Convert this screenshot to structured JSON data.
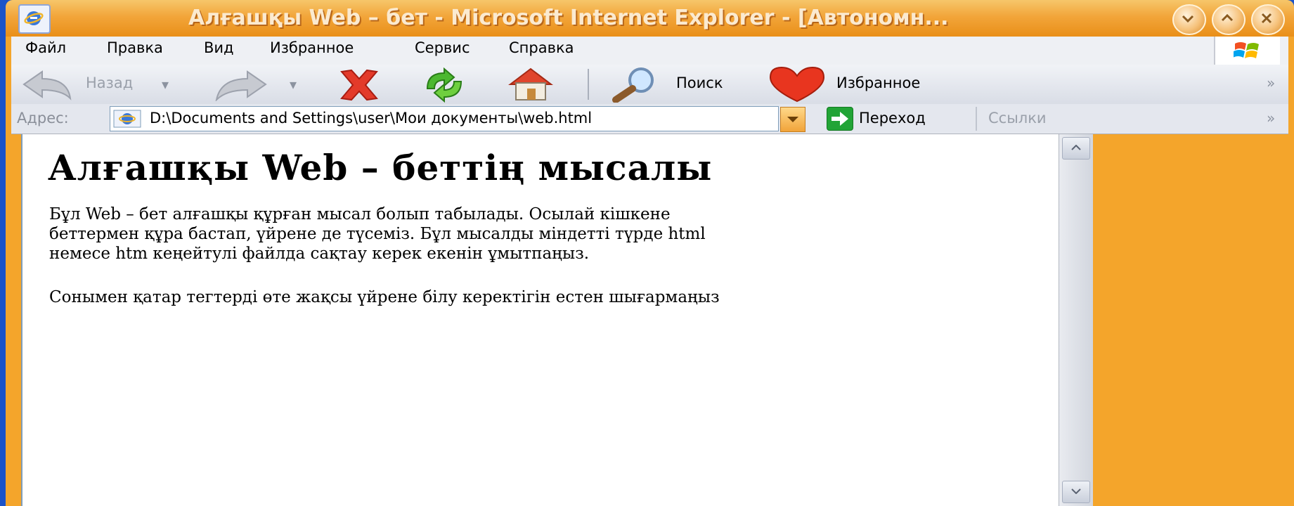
{
  "window": {
    "title": "Алғашқы Web – бет - Microsoft Internet Explorer - [Автономн...",
    "caption_buttons": [
      "minimize-icon",
      "maximize-icon",
      "close-icon"
    ]
  },
  "menu": {
    "items": [
      {
        "label": "Файл"
      },
      {
        "label": "Правка"
      },
      {
        "label": "Вид"
      },
      {
        "label": "Избранное"
      },
      {
        "label": "Сервис"
      },
      {
        "label": "Справка"
      }
    ]
  },
  "toolbar": {
    "back_label": "Назад",
    "search_label": "Поиск",
    "favorites_label": "Избранное",
    "more_chevron": "»",
    "icons": [
      "back-arrow-icon",
      "forward-arrow-icon",
      "stop-icon",
      "refresh-icon",
      "home-icon",
      "search-icon",
      "favorites-heart-icon"
    ]
  },
  "address": {
    "label": "Адрес:",
    "value": "D:\\Documents and Settings\\user\\Мои документы\\web.html",
    "go_label": "Переход",
    "links_label": "Ссылки",
    "links_chevron": "»"
  },
  "page": {
    "heading": "Алғашқы Web – беттің мысалы",
    "paragraph1_lines": [
      "Бұл Web – бет алғашқы құрған мысал болып табылады. Осылай кішкене",
      "беттермен құра бастап, үйрене де түсеміз. Бұл мысалды міндетті түрде html",
      "немесе htm кеңейтулі файлда сақтау керек екенін ұмытпаңыз."
    ],
    "paragraph2": "Сонымен қатар тегтерді өте жақсы үйрене білу керектігін естен шығармаңыз"
  },
  "colors": {
    "titlebar": "#f2a53a",
    "desktop": "#1b53c9",
    "go_button": "#22a436",
    "stop_icon": "#e33a2a",
    "favorites_heart": "#e8351f"
  }
}
